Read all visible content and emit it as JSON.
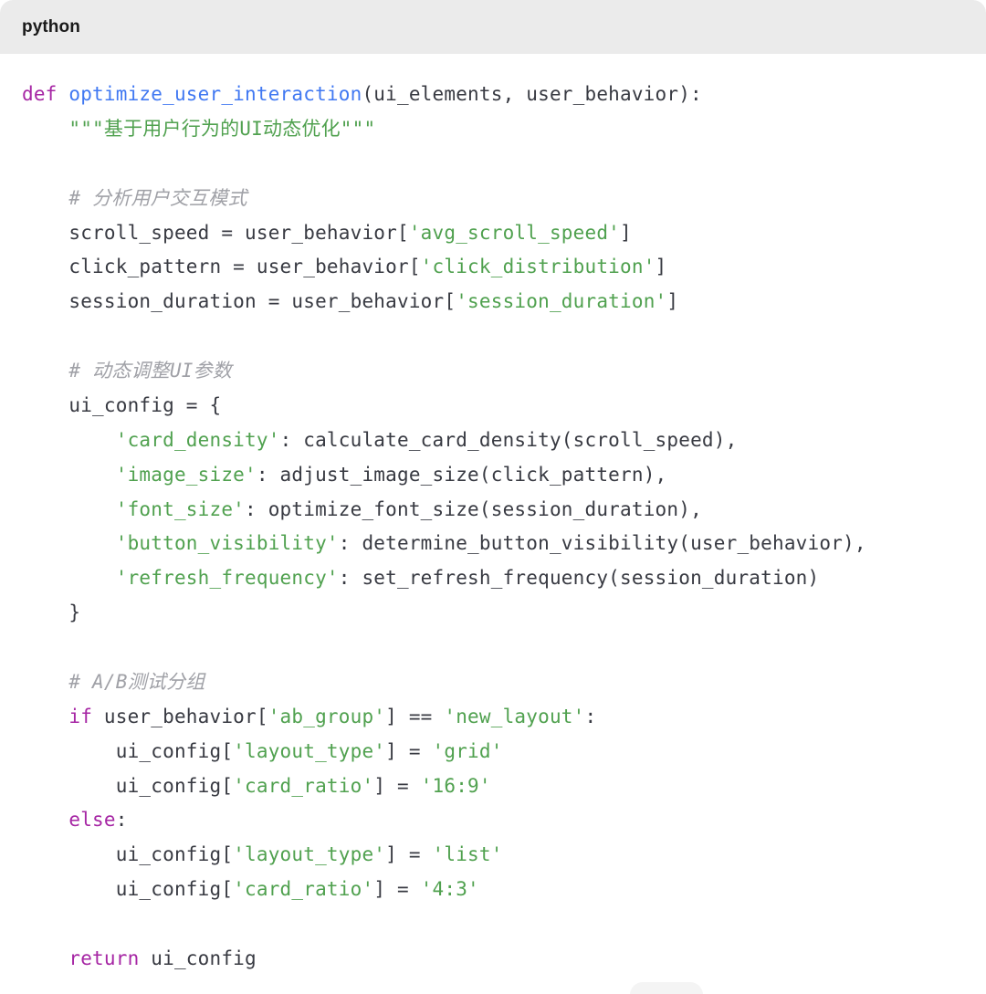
{
  "code_block": {
    "language_label": "python",
    "lines": [
      [
        {
          "t": "keyword",
          "v": "def"
        },
        {
          "t": "plain",
          "v": " "
        },
        {
          "t": "fn",
          "v": "optimize_user_interaction"
        },
        {
          "t": "plain",
          "v": "(ui_elements, user_behavior):"
        }
      ],
      [
        {
          "t": "plain",
          "v": "    "
        },
        {
          "t": "str",
          "v": "\"\"\"基于用户行为的UI动态优化\"\"\""
        }
      ],
      [],
      [
        {
          "t": "plain",
          "v": "    "
        },
        {
          "t": "comment",
          "v": "# 分析用户交互模式"
        }
      ],
      [
        {
          "t": "plain",
          "v": "    scroll_speed = user_behavior["
        },
        {
          "t": "str",
          "v": "'avg_scroll_speed'"
        },
        {
          "t": "plain",
          "v": "]"
        }
      ],
      [
        {
          "t": "plain",
          "v": "    click_pattern = user_behavior["
        },
        {
          "t": "str",
          "v": "'click_distribution'"
        },
        {
          "t": "plain",
          "v": "]"
        }
      ],
      [
        {
          "t": "plain",
          "v": "    session_duration = user_behavior["
        },
        {
          "t": "str",
          "v": "'session_duration'"
        },
        {
          "t": "plain",
          "v": "]"
        }
      ],
      [],
      [
        {
          "t": "plain",
          "v": "    "
        },
        {
          "t": "comment",
          "v": "# 动态调整UI参数"
        }
      ],
      [
        {
          "t": "plain",
          "v": "    ui_config = {"
        }
      ],
      [
        {
          "t": "plain",
          "v": "        "
        },
        {
          "t": "str",
          "v": "'card_density'"
        },
        {
          "t": "plain",
          "v": ": calculate_card_density(scroll_speed),"
        }
      ],
      [
        {
          "t": "plain",
          "v": "        "
        },
        {
          "t": "str",
          "v": "'image_size'"
        },
        {
          "t": "plain",
          "v": ": adjust_image_size(click_pattern),"
        }
      ],
      [
        {
          "t": "plain",
          "v": "        "
        },
        {
          "t": "str",
          "v": "'font_size'"
        },
        {
          "t": "plain",
          "v": ": optimize_font_size(session_duration),"
        }
      ],
      [
        {
          "t": "plain",
          "v": "        "
        },
        {
          "t": "str",
          "v": "'button_visibility'"
        },
        {
          "t": "plain",
          "v": ": determine_button_visibility(user_behavior),"
        }
      ],
      [
        {
          "t": "plain",
          "v": "        "
        },
        {
          "t": "str",
          "v": "'refresh_frequency'"
        },
        {
          "t": "plain",
          "v": ": set_refresh_frequency(session_duration)"
        }
      ],
      [
        {
          "t": "plain",
          "v": "    }"
        }
      ],
      [],
      [
        {
          "t": "plain",
          "v": "    "
        },
        {
          "t": "comment",
          "v": "# A/B测试分组"
        }
      ],
      [
        {
          "t": "plain",
          "v": "    "
        },
        {
          "t": "keyword",
          "v": "if"
        },
        {
          "t": "plain",
          "v": " user_behavior["
        },
        {
          "t": "str",
          "v": "'ab_group'"
        },
        {
          "t": "plain",
          "v": "] == "
        },
        {
          "t": "str",
          "v": "'new_layout'"
        },
        {
          "t": "plain",
          "v": ":"
        }
      ],
      [
        {
          "t": "plain",
          "v": "        ui_config["
        },
        {
          "t": "str",
          "v": "'layout_type'"
        },
        {
          "t": "plain",
          "v": "] = "
        },
        {
          "t": "str",
          "v": "'grid'"
        }
      ],
      [
        {
          "t": "plain",
          "v": "        ui_config["
        },
        {
          "t": "str",
          "v": "'card_ratio'"
        },
        {
          "t": "plain",
          "v": "] = "
        },
        {
          "t": "str",
          "v": "'16:9'"
        }
      ],
      [
        {
          "t": "plain",
          "v": "    "
        },
        {
          "t": "keyword",
          "v": "else"
        },
        {
          "t": "plain",
          "v": ":"
        }
      ],
      [
        {
          "t": "plain",
          "v": "        ui_config["
        },
        {
          "t": "str",
          "v": "'layout_type'"
        },
        {
          "t": "plain",
          "v": "] = "
        },
        {
          "t": "str",
          "v": "'list'"
        }
      ],
      [
        {
          "t": "plain",
          "v": "        ui_config["
        },
        {
          "t": "str",
          "v": "'card_ratio'"
        },
        {
          "t": "plain",
          "v": "] = "
        },
        {
          "t": "str",
          "v": "'4:3'"
        }
      ],
      [],
      [
        {
          "t": "plain",
          "v": "    "
        },
        {
          "t": "keyword",
          "v": "return"
        },
        {
          "t": "plain",
          "v": " ui_config"
        }
      ]
    ]
  },
  "theme_colors": {
    "keyword": "#a626a4",
    "function": "#4078f2",
    "string": "#50a14f",
    "comment": "#a0a1a7",
    "plain": "#383a42",
    "header_background": "#ebebeb"
  }
}
